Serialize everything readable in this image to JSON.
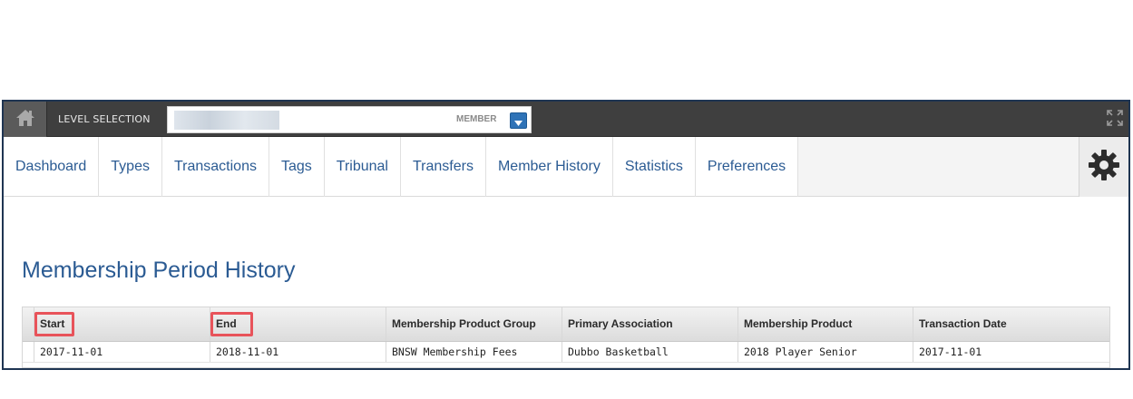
{
  "topbar": {
    "level_label": "LEVEL SELECTION",
    "level_type": "MEMBER",
    "icons": {
      "home": "home-icon",
      "dropdown": "chevron-down-icon",
      "expand": "expand-icon"
    }
  },
  "nav": {
    "items": [
      {
        "label": "Dashboard"
      },
      {
        "label": "Types"
      },
      {
        "label": "Transactions"
      },
      {
        "label": "Tags"
      },
      {
        "label": "Tribunal"
      },
      {
        "label": "Transfers"
      },
      {
        "label": "Member History"
      },
      {
        "label": "Statistics"
      },
      {
        "label": "Preferences"
      }
    ],
    "settings_icon": "gear-icon"
  },
  "page": {
    "title": "Membership Period History"
  },
  "table": {
    "columns": [
      "Start",
      "End",
      "Membership Product Group",
      "Primary Association",
      "Membership Product",
      "Transaction Date"
    ],
    "highlighted_columns": [
      "Start",
      "End"
    ],
    "rows": [
      [
        "2017-11-01",
        "2018-11-01",
        "BNSW Membership Fees",
        "Dubbo Basketball",
        "2018 Player Senior",
        "2017-11-01"
      ]
    ]
  },
  "colors": {
    "accent": "#2b5b93",
    "topbar": "#3f3f3f",
    "highlight": "#e8535a",
    "dropdown": "#2f73b7"
  }
}
